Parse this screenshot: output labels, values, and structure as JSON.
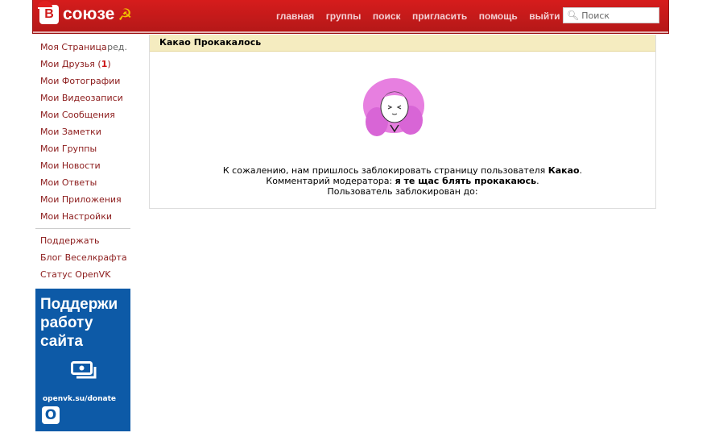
{
  "header": {
    "logo_text": "союзе",
    "logo_badge": "В",
    "nav": [
      "главная",
      "группы",
      "поиск",
      "пригласить",
      "помощь",
      "выйти"
    ],
    "search_placeholder": "Поиск"
  },
  "sidebar": {
    "my_page": "Моя Страница",
    "edit": "ред.",
    "friends": "Мои Друзья",
    "friends_count": "1",
    "items": [
      "Мои Фотографии",
      "Мои Видеозаписи",
      "Мои Сообщения",
      "Мои Заметки",
      "Мои Группы",
      "Мои Новости",
      "Мои Ответы",
      "Мои Приложения",
      "Мои Настройки"
    ],
    "extra": [
      "Поддержать",
      "Блог Веселкрафта",
      "Статус OpenVK"
    ]
  },
  "ad": {
    "line1": "Поддержи",
    "line2": "работу",
    "line3": "сайта",
    "url": "openvk.su/donate",
    "logo": "O"
  },
  "main": {
    "title": "Какао Прокакалось",
    "msg1": "К сожалению, нам пришлось заблокировать страницу пользователя ",
    "user": "Какао",
    "msg2": "Комментарий модератора: ",
    "comment": "я те щас блять прокакаюсь",
    "msg3": "Пользователь заблокирован до:"
  }
}
